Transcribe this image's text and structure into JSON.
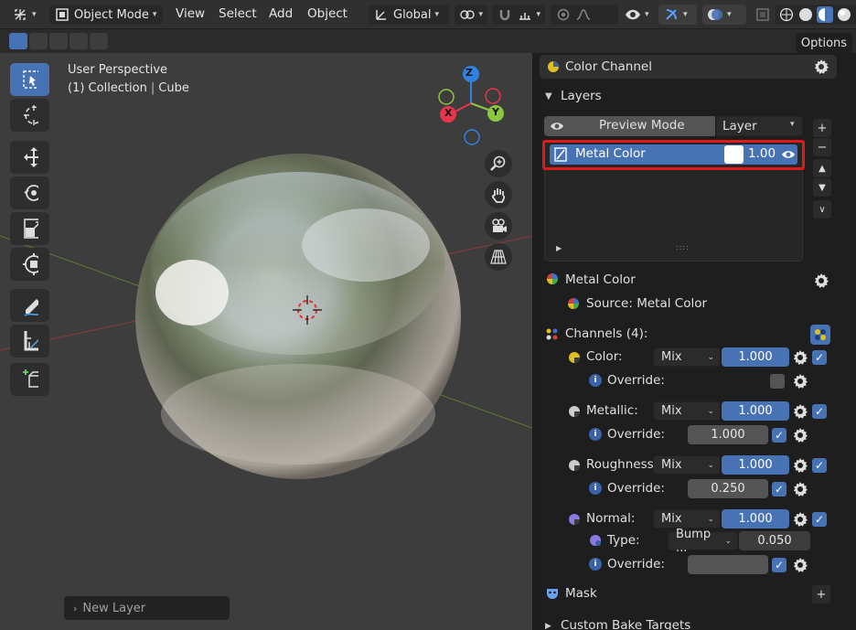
{
  "header": {
    "mode": "Object Mode",
    "menus": [
      "View",
      "Select",
      "Add",
      "Object"
    ],
    "transform_orientation": "Global",
    "options_label": "Options"
  },
  "viewport": {
    "perspective": "User Perspective",
    "collection": "(1) Collection",
    "object": "Cube",
    "gizmo": {
      "z": "Z",
      "x": "X",
      "y": "Y"
    },
    "new_layer": "New Layer",
    "background_color": "#3d3d3d"
  },
  "panel": {
    "color_channel": "Color Channel",
    "layers_title": "Layers",
    "preview_mode": "Preview Mode",
    "layer_dropdown": "Layer",
    "layer_item": {
      "name": "Metal Color",
      "opacity": "1.00"
    },
    "metal_color_title": "Metal Color",
    "source": "Source: Metal Color",
    "channels_title": "Channels (4):",
    "channels": [
      {
        "label": "Color:",
        "blend": "Mix",
        "value": "1.000",
        "override_label": "Override:"
      },
      {
        "label": "Metallic:",
        "blend": "Mix",
        "value": "1.000",
        "override_label": "Override:",
        "override_value": "1.000"
      },
      {
        "label": "Roughness:",
        "blend": "Mix",
        "value": "1.000",
        "override_label": "Override:",
        "override_value": "0.250"
      },
      {
        "label": "Normal:",
        "blend": "Mix",
        "value": "1.000",
        "type_label": "Type:",
        "type_value": "Bump ...",
        "type_amount": "0.050",
        "override_label": "Override:"
      }
    ],
    "mask_title": "Mask",
    "custom_bake_targets": "Custom Bake Targets"
  },
  "colors": {
    "accent": "#4772b3",
    "highlight": "#e01919",
    "axis_x": "#e5364c",
    "axis_y": "#8cc63f",
    "axis_z": "#2f82e0"
  }
}
